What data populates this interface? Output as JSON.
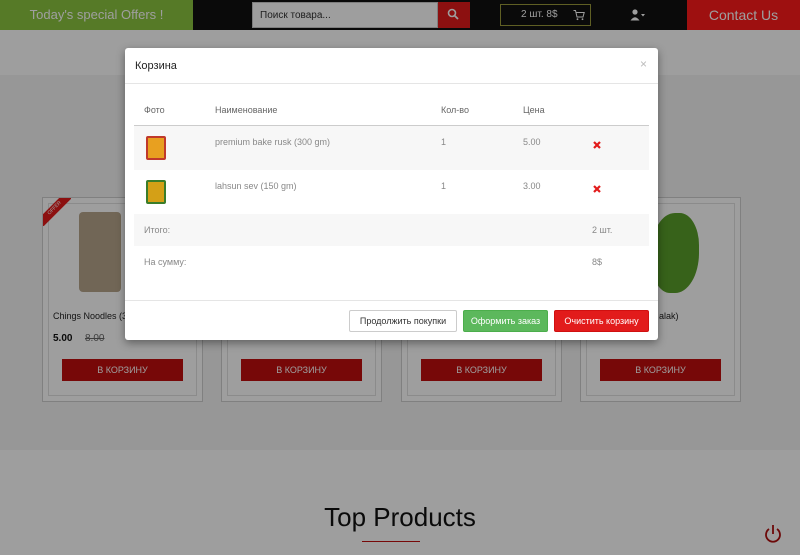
{
  "header": {
    "offers_label": "Today's special Offers !",
    "search_placeholder": "Поиск товара...",
    "cart_summary": "2 шт. 8$",
    "contact_label": "Contact Us"
  },
  "products": [
    {
      "name": "Chings Noodles (3",
      "price": "5.00",
      "old_price": "8.00",
      "button": "В КОРЗИНУ",
      "badge": "OFFER"
    },
    {
      "name": "",
      "price": "",
      "old_price": "",
      "button": "В КОРЗИНУ"
    },
    {
      "name": "",
      "price": "",
      "old_price": "",
      "button": "В КОРЗИНУ"
    },
    {
      "name": "alak)",
      "price": "",
      "old_price": "",
      "button": "В КОРЗИНУ"
    }
  ],
  "section_title": "Top Products",
  "modal": {
    "title": "Корзина",
    "close": "×",
    "columns": {
      "photo": "Фото",
      "name": "Наименование",
      "qty": "Кол-во",
      "price": "Цена"
    },
    "items": [
      {
        "name": "premium bake rusk (300 gm)",
        "qty": "1",
        "price": "5.00"
      },
      {
        "name": "lahsun sev (150 gm)",
        "qty": "1",
        "price": "3.00"
      }
    ],
    "total_count_label": "Итого:",
    "total_count_value": "2 шт.",
    "total_sum_label": "На сумму:",
    "total_sum_value": "8$",
    "buttons": {
      "continue": "Продолжить покупки",
      "checkout": "Оформить заказ",
      "clear": "Очистить корзину"
    }
  },
  "colors": {
    "offers_bg": "#8cc63f",
    "contact_bg": "#ff1a1a",
    "product_button": "#c00d0d",
    "checkout": "#5cb85c",
    "clear": "#e21b1b"
  }
}
